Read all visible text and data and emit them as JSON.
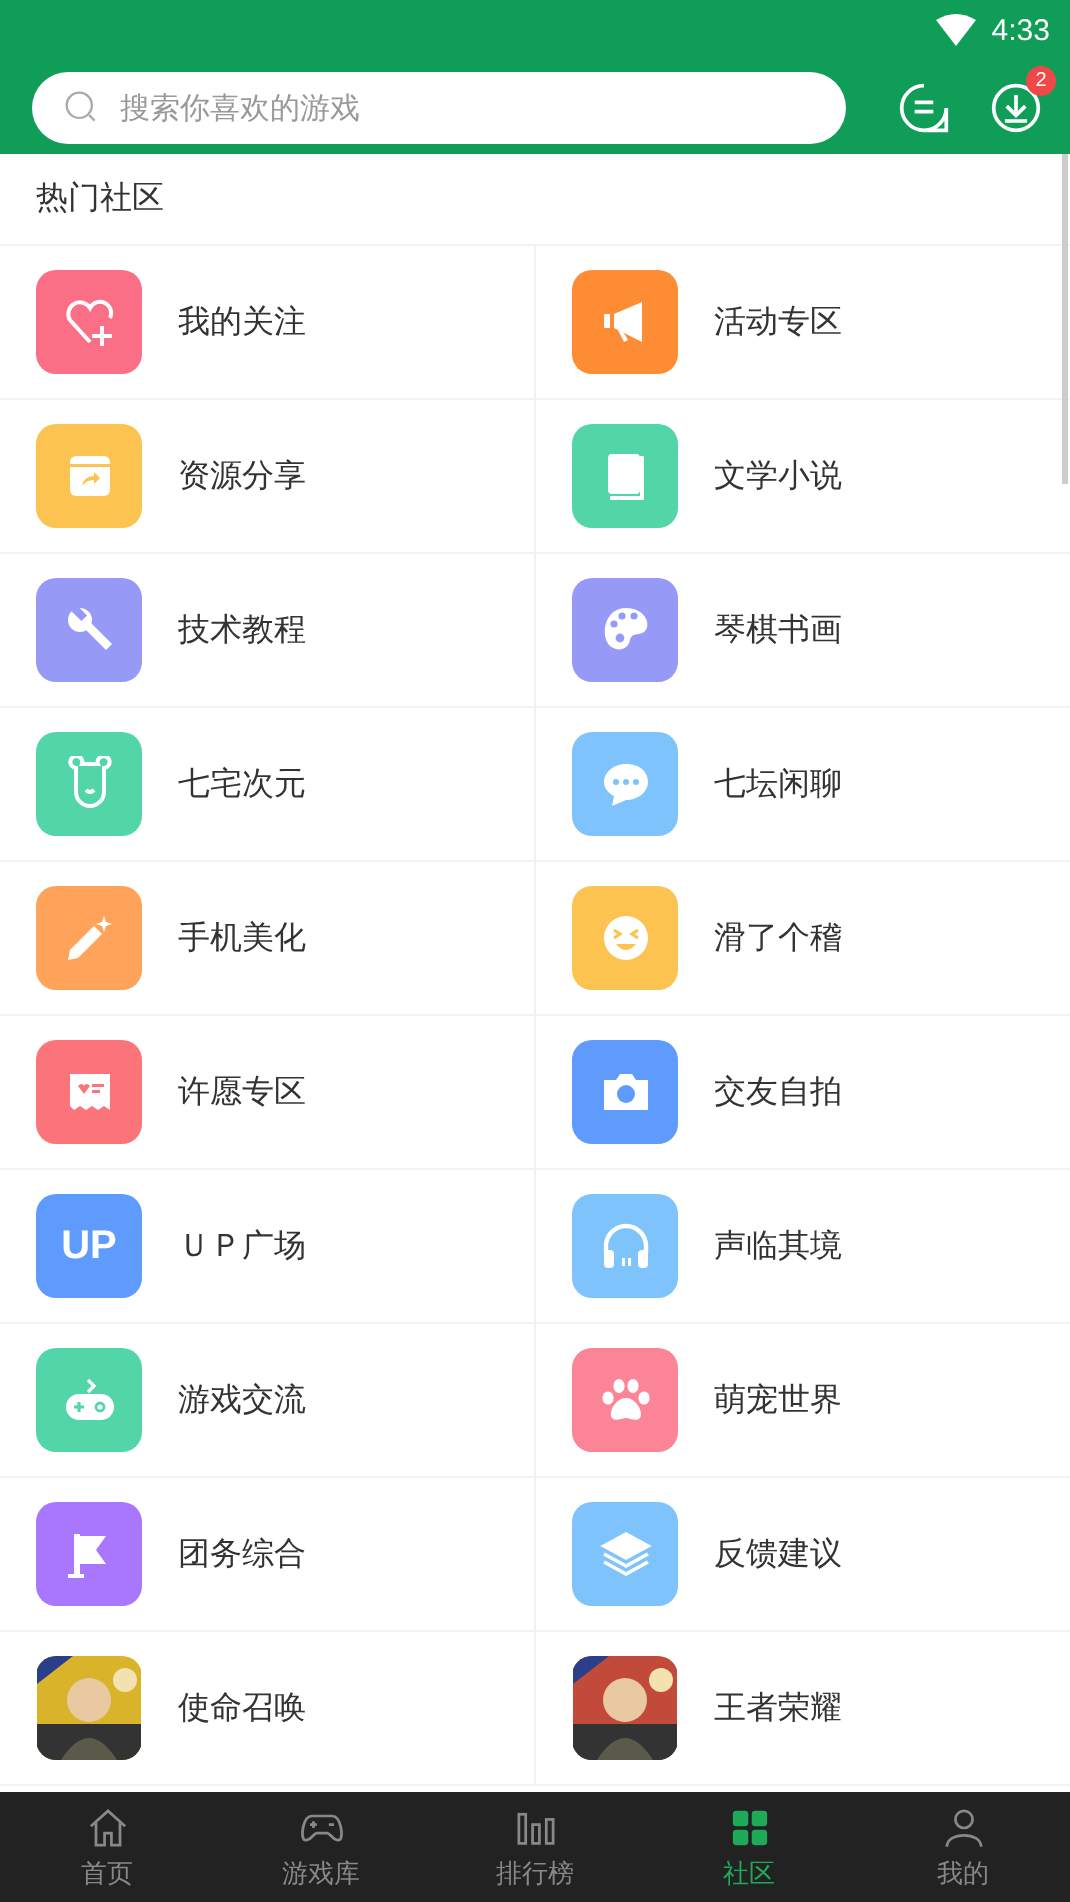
{
  "status_bar": {
    "time": "4:33"
  },
  "search": {
    "placeholder": "搜索你喜欢的游戏"
  },
  "download_badge": "2",
  "section_title": "热门社区",
  "communities": [
    {
      "name": "我的关注",
      "kind": "heart",
      "color": "#fb6f86"
    },
    {
      "name": "活动专区",
      "kind": "megaphone",
      "color": "#fe8c34"
    },
    {
      "name": "资源分享",
      "kind": "share",
      "color": "#fdc350"
    },
    {
      "name": "文学小说",
      "kind": "book",
      "color": "#52d6a8"
    },
    {
      "name": "技术教程",
      "kind": "wrench",
      "color": "#969af6"
    },
    {
      "name": "琴棋书画",
      "kind": "palette",
      "color": "#969af6"
    },
    {
      "name": "七宅次元",
      "kind": "bear",
      "color": "#52d6a8"
    },
    {
      "name": "七坛闲聊",
      "kind": "chat",
      "color": "#7fc3fd"
    },
    {
      "name": "手机美化",
      "kind": "pen",
      "color": "#ffa25a"
    },
    {
      "name": "滑了个稽",
      "kind": "smiley",
      "color": "#fdc350"
    },
    {
      "name": "许愿专区",
      "kind": "ticket",
      "color": "#fb7479"
    },
    {
      "name": "交友自拍",
      "kind": "camera",
      "color": "#5f9bfd"
    },
    {
      "name": "ＵＰ广场",
      "kind": "text",
      "icon_text": "UP",
      "color": "#5f9bfd"
    },
    {
      "name": "声临其境",
      "kind": "headphones",
      "color": "#7fc3fd"
    },
    {
      "name": "游戏交流",
      "kind": "gamepad",
      "color": "#52d6a8"
    },
    {
      "name": "萌宠世界",
      "kind": "paw",
      "color": "#fb8596"
    },
    {
      "name": "团务综合",
      "kind": "flag",
      "color": "#a877fd"
    },
    {
      "name": "反馈建议",
      "kind": "layers",
      "color": "#7fc3fd"
    },
    {
      "name": "使命召唤",
      "kind": "picture"
    },
    {
      "name": "王者荣耀",
      "kind": "picture"
    }
  ],
  "nav": [
    {
      "label": "首页",
      "kind": "home",
      "selected": false
    },
    {
      "label": "游戏库",
      "kind": "gamepad",
      "selected": false
    },
    {
      "label": "排行榜",
      "kind": "chart",
      "selected": false
    },
    {
      "label": "社区",
      "kind": "community",
      "selected": true
    },
    {
      "label": "我的",
      "kind": "person",
      "selected": false
    }
  ]
}
